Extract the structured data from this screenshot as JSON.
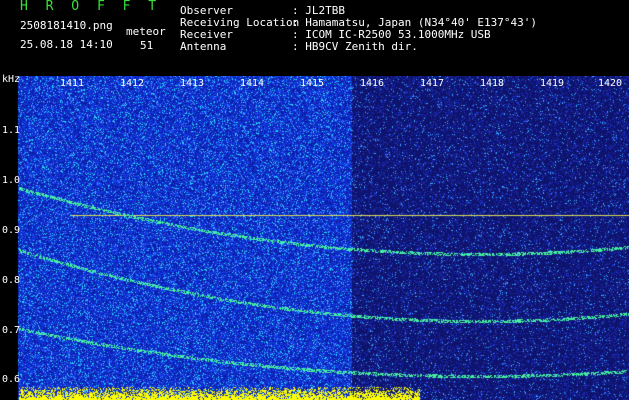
{
  "header": {
    "app_title": "H R O F F T",
    "file_name": "2508181410.png",
    "datetime": "25.08.18 14:10",
    "meteor_label": "meteor",
    "meteor_count": "51"
  },
  "station": [
    {
      "key": "Observer",
      "value": ": JL2TBB"
    },
    {
      "key": "Receiving Location",
      "value": ": Hamamatsu, Japan (N34°40' E137°43')"
    },
    {
      "key": "Receiver",
      "value": ": ICOM IC-R2500 53.1000MHz USB"
    },
    {
      "key": "Antenna",
      "value": ": HB9CV Zenith dir."
    }
  ],
  "spectrogram": {
    "y_unit": "kHz",
    "y_ticks": [
      "1.1",
      "1.0",
      "0.9",
      "0.8",
      "0.7",
      "0.6"
    ],
    "x_ticks": [
      "1411",
      "1412",
      "1413",
      "1414",
      "1415",
      "1416",
      "1417",
      "1418",
      "1419",
      "1420"
    ]
  },
  "colors": {
    "background": "#000000",
    "noise_blue": "#1a3cff",
    "noise_dark": "#141a80",
    "trace_cyan": "#40e0ff",
    "trace_green": "#60ff60",
    "trace_yellow": "#ffff00",
    "title_green": "#38e038"
  }
}
